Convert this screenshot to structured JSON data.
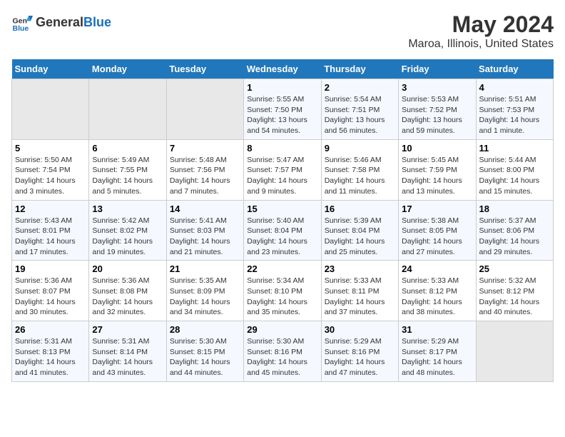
{
  "header": {
    "logo_general": "General",
    "logo_blue": "Blue",
    "main_title": "May 2024",
    "subtitle": "Maroa, Illinois, United States"
  },
  "days_of_week": [
    "Sunday",
    "Monday",
    "Tuesday",
    "Wednesday",
    "Thursday",
    "Friday",
    "Saturday"
  ],
  "weeks": [
    [
      {
        "day": "",
        "empty": true
      },
      {
        "day": "",
        "empty": true
      },
      {
        "day": "",
        "empty": true
      },
      {
        "day": "1",
        "sunrise": "Sunrise: 5:55 AM",
        "sunset": "Sunset: 7:50 PM",
        "daylight": "Daylight: 13 hours and 54 minutes."
      },
      {
        "day": "2",
        "sunrise": "Sunrise: 5:54 AM",
        "sunset": "Sunset: 7:51 PM",
        "daylight": "Daylight: 13 hours and 56 minutes."
      },
      {
        "day": "3",
        "sunrise": "Sunrise: 5:53 AM",
        "sunset": "Sunset: 7:52 PM",
        "daylight": "Daylight: 13 hours and 59 minutes."
      },
      {
        "day": "4",
        "sunrise": "Sunrise: 5:51 AM",
        "sunset": "Sunset: 7:53 PM",
        "daylight": "Daylight: 14 hours and 1 minute."
      }
    ],
    [
      {
        "day": "5",
        "sunrise": "Sunrise: 5:50 AM",
        "sunset": "Sunset: 7:54 PM",
        "daylight": "Daylight: 14 hours and 3 minutes."
      },
      {
        "day": "6",
        "sunrise": "Sunrise: 5:49 AM",
        "sunset": "Sunset: 7:55 PM",
        "daylight": "Daylight: 14 hours and 5 minutes."
      },
      {
        "day": "7",
        "sunrise": "Sunrise: 5:48 AM",
        "sunset": "Sunset: 7:56 PM",
        "daylight": "Daylight: 14 hours and 7 minutes."
      },
      {
        "day": "8",
        "sunrise": "Sunrise: 5:47 AM",
        "sunset": "Sunset: 7:57 PM",
        "daylight": "Daylight: 14 hours and 9 minutes."
      },
      {
        "day": "9",
        "sunrise": "Sunrise: 5:46 AM",
        "sunset": "Sunset: 7:58 PM",
        "daylight": "Daylight: 14 hours and 11 minutes."
      },
      {
        "day": "10",
        "sunrise": "Sunrise: 5:45 AM",
        "sunset": "Sunset: 7:59 PM",
        "daylight": "Daylight: 14 hours and 13 minutes."
      },
      {
        "day": "11",
        "sunrise": "Sunrise: 5:44 AM",
        "sunset": "Sunset: 8:00 PM",
        "daylight": "Daylight: 14 hours and 15 minutes."
      }
    ],
    [
      {
        "day": "12",
        "sunrise": "Sunrise: 5:43 AM",
        "sunset": "Sunset: 8:01 PM",
        "daylight": "Daylight: 14 hours and 17 minutes."
      },
      {
        "day": "13",
        "sunrise": "Sunrise: 5:42 AM",
        "sunset": "Sunset: 8:02 PM",
        "daylight": "Daylight: 14 hours and 19 minutes."
      },
      {
        "day": "14",
        "sunrise": "Sunrise: 5:41 AM",
        "sunset": "Sunset: 8:03 PM",
        "daylight": "Daylight: 14 hours and 21 minutes."
      },
      {
        "day": "15",
        "sunrise": "Sunrise: 5:40 AM",
        "sunset": "Sunset: 8:04 PM",
        "daylight": "Daylight: 14 hours and 23 minutes."
      },
      {
        "day": "16",
        "sunrise": "Sunrise: 5:39 AM",
        "sunset": "Sunset: 8:04 PM",
        "daylight": "Daylight: 14 hours and 25 minutes."
      },
      {
        "day": "17",
        "sunrise": "Sunrise: 5:38 AM",
        "sunset": "Sunset: 8:05 PM",
        "daylight": "Daylight: 14 hours and 27 minutes."
      },
      {
        "day": "18",
        "sunrise": "Sunrise: 5:37 AM",
        "sunset": "Sunset: 8:06 PM",
        "daylight": "Daylight: 14 hours and 29 minutes."
      }
    ],
    [
      {
        "day": "19",
        "sunrise": "Sunrise: 5:36 AM",
        "sunset": "Sunset: 8:07 PM",
        "daylight": "Daylight: 14 hours and 30 minutes."
      },
      {
        "day": "20",
        "sunrise": "Sunrise: 5:36 AM",
        "sunset": "Sunset: 8:08 PM",
        "daylight": "Daylight: 14 hours and 32 minutes."
      },
      {
        "day": "21",
        "sunrise": "Sunrise: 5:35 AM",
        "sunset": "Sunset: 8:09 PM",
        "daylight": "Daylight: 14 hours and 34 minutes."
      },
      {
        "day": "22",
        "sunrise": "Sunrise: 5:34 AM",
        "sunset": "Sunset: 8:10 PM",
        "daylight": "Daylight: 14 hours and 35 minutes."
      },
      {
        "day": "23",
        "sunrise": "Sunrise: 5:33 AM",
        "sunset": "Sunset: 8:11 PM",
        "daylight": "Daylight: 14 hours and 37 minutes."
      },
      {
        "day": "24",
        "sunrise": "Sunrise: 5:33 AM",
        "sunset": "Sunset: 8:12 PM",
        "daylight": "Daylight: 14 hours and 38 minutes."
      },
      {
        "day": "25",
        "sunrise": "Sunrise: 5:32 AM",
        "sunset": "Sunset: 8:12 PM",
        "daylight": "Daylight: 14 hours and 40 minutes."
      }
    ],
    [
      {
        "day": "26",
        "sunrise": "Sunrise: 5:31 AM",
        "sunset": "Sunset: 8:13 PM",
        "daylight": "Daylight: 14 hours and 41 minutes."
      },
      {
        "day": "27",
        "sunrise": "Sunrise: 5:31 AM",
        "sunset": "Sunset: 8:14 PM",
        "daylight": "Daylight: 14 hours and 43 minutes."
      },
      {
        "day": "28",
        "sunrise": "Sunrise: 5:30 AM",
        "sunset": "Sunset: 8:15 PM",
        "daylight": "Daylight: 14 hours and 44 minutes."
      },
      {
        "day": "29",
        "sunrise": "Sunrise: 5:30 AM",
        "sunset": "Sunset: 8:16 PM",
        "daylight": "Daylight: 14 hours and 45 minutes."
      },
      {
        "day": "30",
        "sunrise": "Sunrise: 5:29 AM",
        "sunset": "Sunset: 8:16 PM",
        "daylight": "Daylight: 14 hours and 47 minutes."
      },
      {
        "day": "31",
        "sunrise": "Sunrise: 5:29 AM",
        "sunset": "Sunset: 8:17 PM",
        "daylight": "Daylight: 14 hours and 48 minutes."
      },
      {
        "day": "",
        "empty": true
      }
    ]
  ]
}
